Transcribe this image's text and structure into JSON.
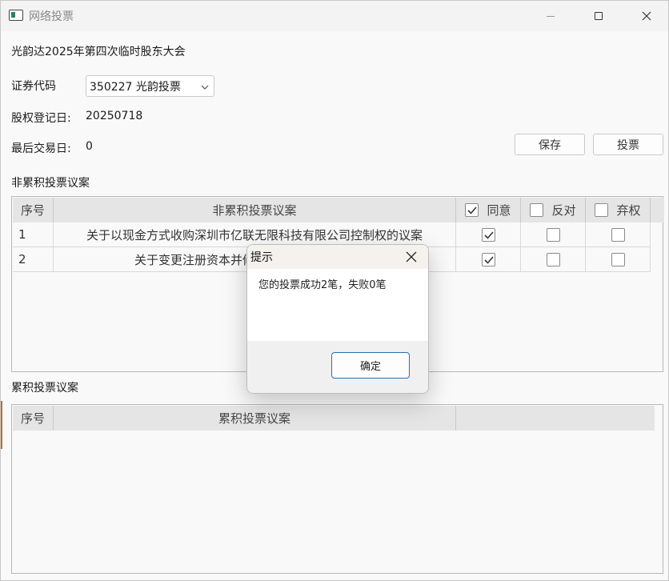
{
  "window": {
    "title": "网络投票"
  },
  "meeting": {
    "title": "光韵达2025年第四次临时股东大会"
  },
  "form": {
    "security_code_label": "证券代码",
    "security_code_value": "350227 光韵投票",
    "registration_date_label": "股权登记日:",
    "registration_date_value": "20250718",
    "last_trade_date_label": "最后交易日:",
    "last_trade_date_value": "0"
  },
  "buttons": {
    "save": "保存",
    "vote": "投票"
  },
  "non_cumulative": {
    "section_label": "非累积投票议案",
    "headers": {
      "index": "序号",
      "proposal": "非累积投票议案",
      "agree": "同意",
      "oppose": "反对",
      "abstain": "弃权"
    },
    "header_checks": {
      "agree": true,
      "oppose": false,
      "abstain": false
    },
    "rows": [
      {
        "index": "1",
        "proposal": "关于以现金方式收购深圳市亿联无限科技有限公司控制权的议案",
        "agree": true,
        "oppose": false,
        "abstain": false
      },
      {
        "index": "2",
        "proposal": "关于变更注册资本并修订《公司章程》的议案",
        "agree": true,
        "oppose": false,
        "abstain": false
      }
    ]
  },
  "cumulative": {
    "section_label": "累积投票议案",
    "headers": {
      "index": "序号",
      "proposal": "累积投票议案"
    }
  },
  "dialog": {
    "title": "提示",
    "message": "您的投票成功2笔，失败0笔",
    "ok": "确定"
  }
}
